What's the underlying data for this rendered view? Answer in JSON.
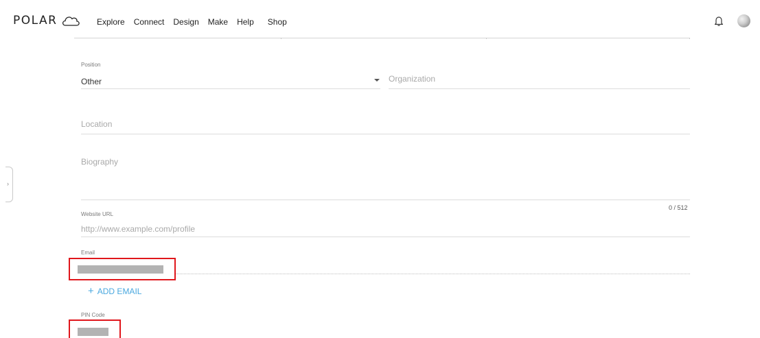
{
  "header": {
    "logo_text": "POLAR",
    "logo_icon": "cloud-icon",
    "nav": [
      "Explore",
      "Connect",
      "Design",
      "Make",
      "Help",
      "Shop"
    ],
    "bell_icon": "bell-icon",
    "avatar_icon": "avatar-icon"
  },
  "form": {
    "position": {
      "label": "Position",
      "value": "Other"
    },
    "organization": {
      "placeholder": "Organization"
    },
    "location": {
      "placeholder": "Location"
    },
    "biography": {
      "placeholder": "Biography",
      "counter": "0 / 512"
    },
    "website": {
      "label": "Website URL",
      "placeholder": "http://www.example.com/profile"
    },
    "email": {
      "label": "Email",
      "add_label": "ADD EMAIL"
    },
    "pin": {
      "label": "PIN Code"
    }
  },
  "colors": {
    "accent": "#4aa8df",
    "highlight": "#e0161b",
    "redacted": "#b3b3b3"
  }
}
